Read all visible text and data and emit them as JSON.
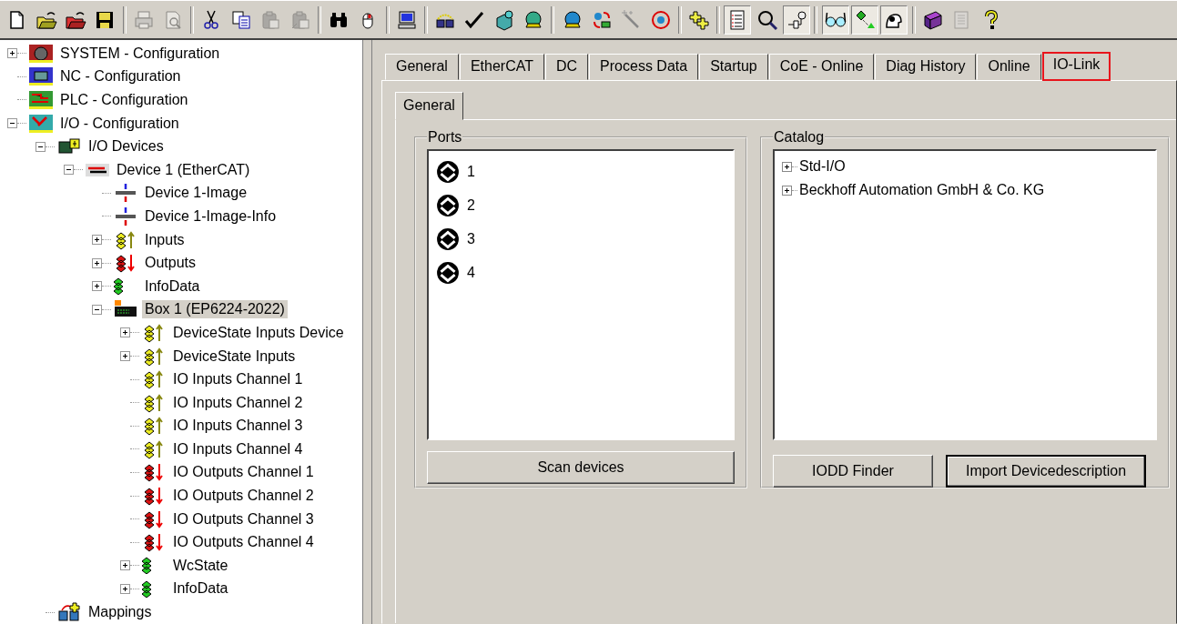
{
  "toolbar": [
    {
      "kind": "button",
      "disabled": false
    },
    {
      "kind": "button",
      "disabled": false
    },
    {
      "kind": "button",
      "disabled": false
    },
    {
      "kind": "button",
      "disabled": false
    },
    {
      "kind": "separator"
    },
    {
      "kind": "button",
      "disabled": true
    },
    {
      "kind": "button",
      "disabled": true
    },
    {
      "kind": "separator"
    },
    {
      "kind": "button",
      "disabled": false
    },
    {
      "kind": "button",
      "disabled": false
    },
    {
      "kind": "button",
      "disabled": true
    },
    {
      "kind": "button",
      "disabled": true
    },
    {
      "kind": "separator"
    },
    {
      "kind": "button",
      "disabled": false
    },
    {
      "kind": "button",
      "disabled": false
    },
    {
      "kind": "separator"
    },
    {
      "kind": "button",
      "disabled": false
    },
    {
      "kind": "separator"
    },
    {
      "kind": "button",
      "disabled": false
    },
    {
      "kind": "button",
      "disabled": false
    },
    {
      "kind": "button",
      "disabled": false
    },
    {
      "kind": "button",
      "disabled": false
    },
    {
      "kind": "separator"
    },
    {
      "kind": "button",
      "disabled": false
    },
    {
      "kind": "button",
      "disabled": false
    },
    {
      "kind": "button",
      "disabled": false
    },
    {
      "kind": "button",
      "disabled": false
    },
    {
      "kind": "separator"
    },
    {
      "kind": "button",
      "disabled": false
    },
    {
      "kind": "separator"
    },
    {
      "kind": "toggle",
      "disabled": false,
      "pressed": true
    },
    {
      "kind": "button",
      "disabled": false
    },
    {
      "kind": "toggle",
      "disabled": false,
      "pressed": true
    },
    {
      "kind": "separator"
    },
    {
      "kind": "toggle",
      "disabled": false,
      "pressed": true
    },
    {
      "kind": "toggle",
      "disabled": false,
      "pressed": true
    },
    {
      "kind": "toggle",
      "disabled": false,
      "pressed": true
    },
    {
      "kind": "separator"
    },
    {
      "kind": "button",
      "disabled": false
    },
    {
      "kind": "button",
      "disabled": true
    },
    {
      "kind": "button",
      "disabled": false
    }
  ],
  "tree": [
    {
      "label": "SYSTEM - Configuration",
      "kind": "system",
      "expanded": false,
      "selected": false
    },
    {
      "label": "NC - Configuration",
      "kind": "nc",
      "selected": false
    },
    {
      "label": "PLC - Configuration",
      "kind": "plc",
      "selected": false
    },
    {
      "label": "I/O - Configuration",
      "kind": "io",
      "expanded": true,
      "selected": false,
      "children": [
        {
          "label": "I/O Devices",
          "kind": "devices",
          "expanded": true,
          "selected": false,
          "children": [
            {
              "label": "Device 1 (EtherCAT)",
              "kind": "ethercat",
              "expanded": true,
              "selected": false,
              "children": [
                {
                  "label": "Device 1-Image",
                  "kind": "image",
                  "selected": false
                },
                {
                  "label": "Device 1-Image-Info",
                  "kind": "image",
                  "selected": false
                },
                {
                  "label": "Inputs",
                  "kind": "inputs",
                  "expanded": false,
                  "selected": false
                },
                {
                  "label": "Outputs",
                  "kind": "outputs",
                  "expanded": false,
                  "selected": false
                },
                {
                  "label": "InfoData",
                  "kind": "status",
                  "expanded": false,
                  "selected": false
                },
                {
                  "label": "Box 1 (EP6224-2022)",
                  "kind": "box",
                  "expanded": true,
                  "selected": true,
                  "children": [
                    {
                      "label": "DeviceState Inputs Device",
                      "kind": "inputs",
                      "expanded": false,
                      "selected": false
                    },
                    {
                      "label": "DeviceState Inputs",
                      "kind": "inputs",
                      "expanded": false,
                      "selected": false
                    },
                    {
                      "label": "IO Inputs Channel 1",
                      "kind": "inputs",
                      "selected": false
                    },
                    {
                      "label": "IO Inputs Channel 2",
                      "kind": "inputs",
                      "selected": false
                    },
                    {
                      "label": "IO Inputs Channel 3",
                      "kind": "inputs",
                      "selected": false
                    },
                    {
                      "label": "IO Inputs Channel 4",
                      "kind": "inputs",
                      "selected": false
                    },
                    {
                      "label": "IO Outputs Channel 1",
                      "kind": "outputs",
                      "selected": false
                    },
                    {
                      "label": "IO Outputs Channel 2",
                      "kind": "outputs",
                      "selected": false
                    },
                    {
                      "label": "IO Outputs Channel 3",
                      "kind": "outputs",
                      "selected": false
                    },
                    {
                      "label": "IO Outputs Channel 4",
                      "kind": "outputs",
                      "selected": false
                    },
                    {
                      "label": "WcState",
                      "kind": "status",
                      "expanded": false,
                      "selected": false
                    },
                    {
                      "label": "InfoData",
                      "kind": "status",
                      "expanded": false,
                      "selected": false
                    }
                  ]
                }
              ]
            }
          ]
        },
        {
          "label": "Mappings",
          "kind": "mappings",
          "selected": false
        }
      ]
    }
  ],
  "tabs": [
    {
      "label": "General",
      "selected": false,
      "highlighted": false
    },
    {
      "label": "EtherCAT",
      "selected": false,
      "highlighted": false
    },
    {
      "label": "DC",
      "selected": false,
      "highlighted": false
    },
    {
      "label": "Process Data",
      "selected": false,
      "highlighted": false
    },
    {
      "label": "Startup",
      "selected": false,
      "highlighted": false
    },
    {
      "label": "CoE - Online",
      "selected": false,
      "highlighted": false
    },
    {
      "label": "Diag History",
      "selected": false,
      "highlighted": false
    },
    {
      "label": "Online",
      "selected": false,
      "highlighted": false
    },
    {
      "label": "IO-Link",
      "selected": true,
      "highlighted": true
    }
  ],
  "subtabs": [
    {
      "label": "General",
      "selected": true
    }
  ],
  "ports": {
    "title": "Ports",
    "items": [
      {
        "label": "1"
      },
      {
        "label": "2"
      },
      {
        "label": "3"
      },
      {
        "label": "4"
      }
    ],
    "button": "Scan devices"
  },
  "catalog": {
    "title": "Catalog",
    "items": [
      {
        "label": "Std-I/O",
        "expanded": false
      },
      {
        "label": "Beckhoff Automation GmbH & Co. KG",
        "expanded": false
      }
    ],
    "buttons": [
      {
        "label": "IODD Finder",
        "default": false
      },
      {
        "label": "Import Devicedescription",
        "default": true
      }
    ]
  }
}
